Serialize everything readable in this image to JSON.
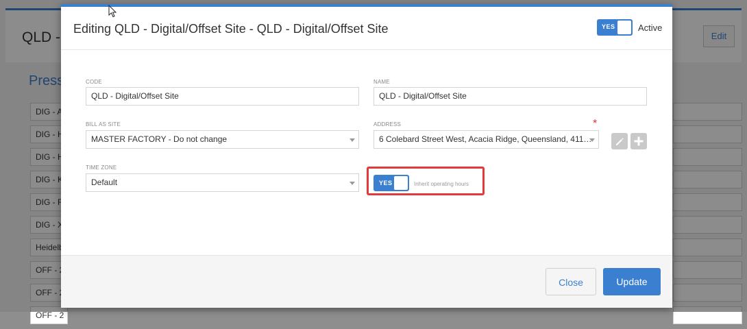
{
  "background": {
    "title": "QLD - ",
    "edit_label": "Edit",
    "section_title": "Press",
    "left_items": [
      "DIG - A",
      "DIG - H",
      "DIG - H",
      "DIG - K",
      "DIG - R",
      "DIG - X",
      "Heidelb",
      "OFF - 2",
      "OFF - 2",
      "OFF - 2"
    ]
  },
  "modal": {
    "title": "Editing QLD - Digital/Offset Site - QLD - Digital/Offset Site",
    "active_toggle": "YES",
    "active_label": "Active",
    "code": {
      "label": "CODE",
      "value": "QLD - Digital/Offset Site"
    },
    "name": {
      "label": "NAME",
      "value": "QLD - Digital/Offset Site"
    },
    "bill_as_site": {
      "label": "BILL AS SITE",
      "value": "MASTER FACTORY - Do not change"
    },
    "address": {
      "label": "ADDRESS",
      "value": "6 Colebard Street West, Acacia Ridge, Queensland, 411…",
      "required": "*"
    },
    "time_zone": {
      "label": "TIME ZONE",
      "value": "Default"
    },
    "inherit_toggle": "YES",
    "inherit_label": "Inherit operating hours",
    "close_label": "Close",
    "update_label": "Update"
  },
  "colors": {
    "accent": "#3a7fd0",
    "highlight": "#e03a3a"
  }
}
